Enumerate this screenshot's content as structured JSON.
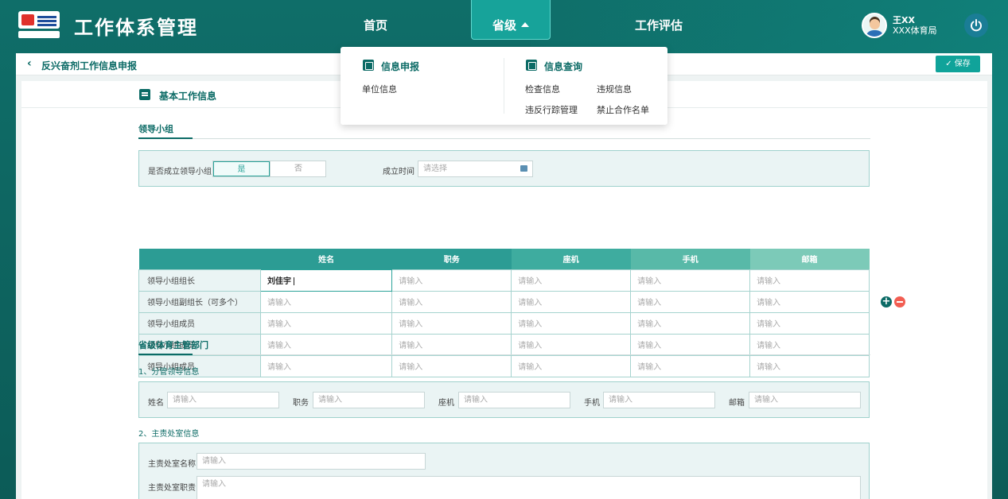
{
  "header": {
    "title": "工作体系管理",
    "nav": {
      "home": "首页",
      "province": "省级",
      "evaluation": "工作评估"
    },
    "user": {
      "name": "王XX",
      "org": "XXX体育局"
    }
  },
  "dropdown": {
    "report": {
      "title": "信息申报",
      "items": [
        "单位信息"
      ]
    },
    "query": {
      "title": "信息查询",
      "items": [
        "检查信息",
        "违规信息",
        "违反行踪管理",
        "禁止合作名单"
      ]
    }
  },
  "crumb": {
    "back": "‹",
    "title": "反兴奋剂工作信息申报",
    "save": "保存"
  },
  "section": {
    "title": "基本工作信息"
  },
  "leading_group": {
    "title": "领导小组",
    "established_label": "是否成立领导小组",
    "yes": "是",
    "no": "否",
    "date_label": "成立时间",
    "date_placeholder": "请选择",
    "columns": [
      "",
      "姓名",
      "职务",
      "座机",
      "手机",
      "邮箱"
    ],
    "rows": [
      {
        "role": "领导小组组长",
        "cells": [
          "刘佳宇",
          "请输入",
          "请输入",
          "请输入",
          "请输入"
        ]
      },
      {
        "role": "领导小组副组长（可多个）",
        "cells": [
          "请输入",
          "请输入",
          "请输入",
          "请输入",
          "请输入"
        ]
      },
      {
        "role": "领导小组成员",
        "cells": [
          "请输入",
          "请输入",
          "请输入",
          "请输入",
          "请输入"
        ]
      },
      {
        "role": "领导小组成员",
        "cells": [
          "请输入",
          "请输入",
          "请输入",
          "请输入",
          "请输入"
        ]
      },
      {
        "role": "领导小组成员",
        "cells": [
          "请输入",
          "请输入",
          "请输入",
          "请输入",
          "请输入"
        ]
      }
    ]
  },
  "dept": {
    "title": "省级体育主管部门",
    "sub1": "1、分管领导信息",
    "fields": {
      "name": "姓名",
      "duty": "职务",
      "phone": "座机",
      "mobile": "手机",
      "email": "邮箱",
      "placeholder": "请输入"
    },
    "sub2": "2、主责处室信息",
    "office_name": "主责处室名称",
    "office_duty": "主责处室职责"
  }
}
